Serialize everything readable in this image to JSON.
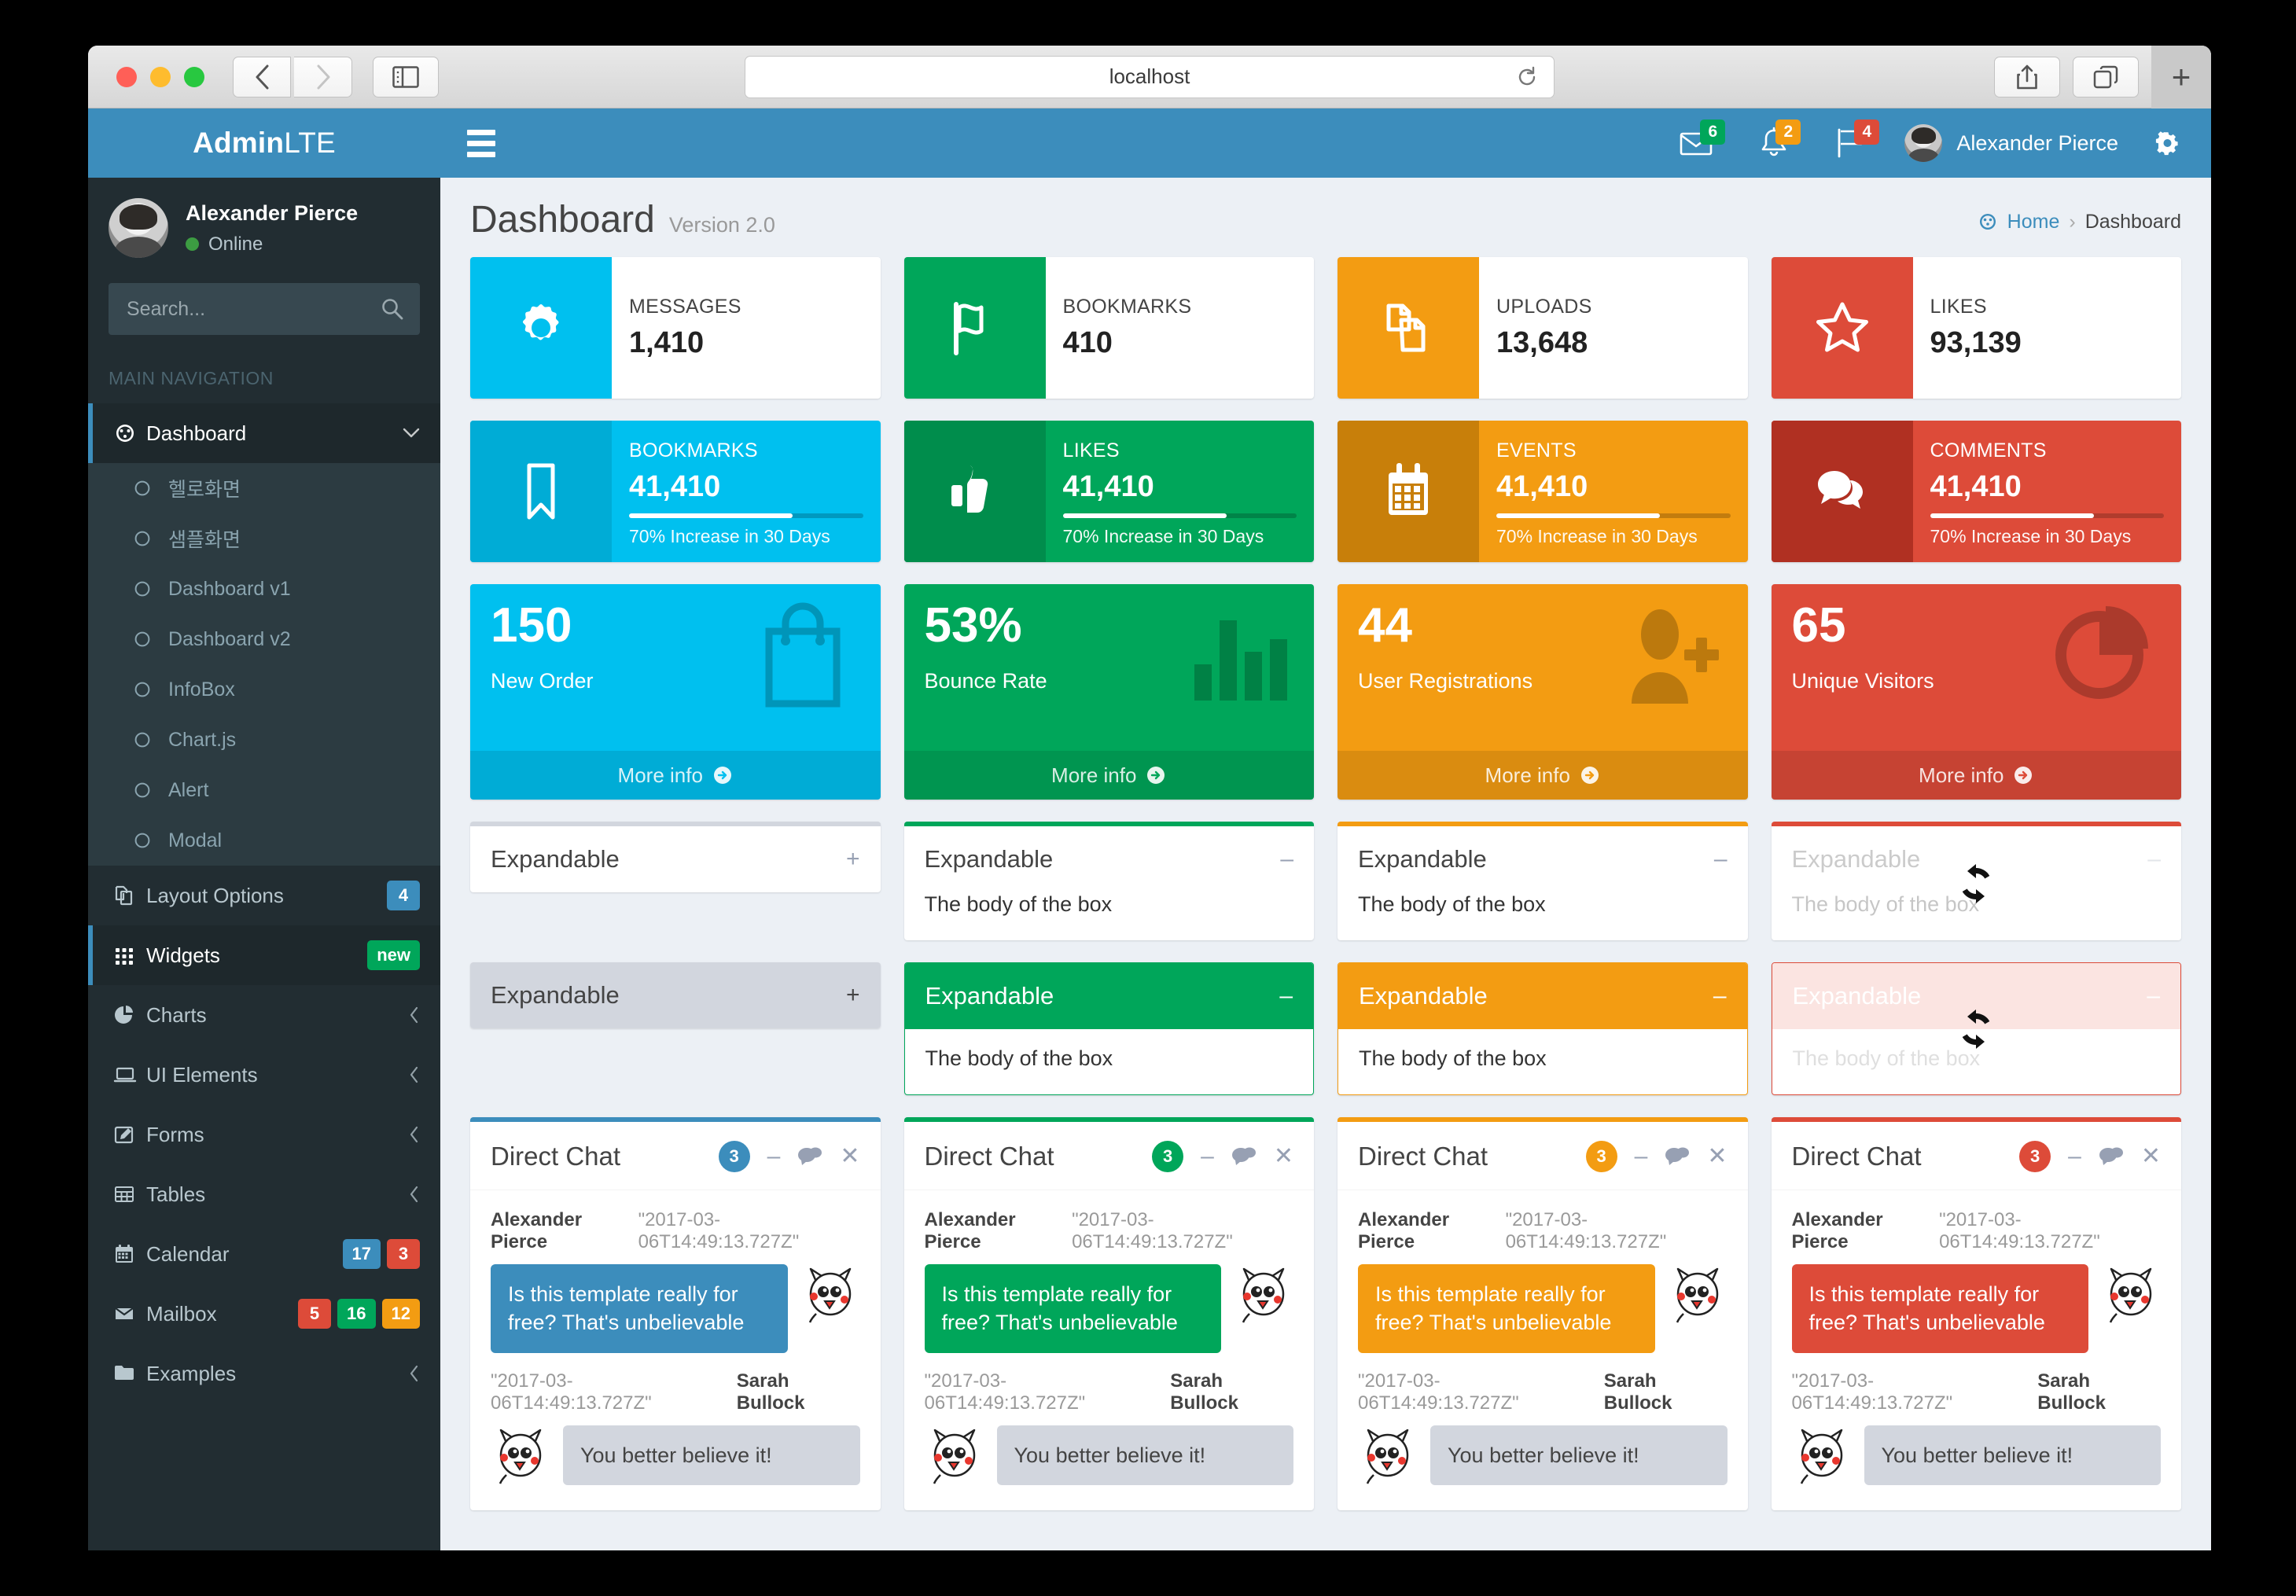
{
  "browser": {
    "url": "localhost",
    "back_label": "Back",
    "forward_label": "Forward",
    "sidebar_label": "Show Sidebar",
    "share_label": "Share",
    "tabs_label": "Show Tabs",
    "newtab_label": "+",
    "reload_label": "Reload"
  },
  "sidebar": {
    "logo_bold": "Admin",
    "logo_light": "LTE",
    "user": {
      "name": "Alexander Pierce",
      "status": "Online"
    },
    "search": {
      "placeholder": "Search...",
      "value": ""
    },
    "nav_header": "MAIN NAVIGATION",
    "items": [
      {
        "label": "Dashboard",
        "icon": "dashboard-icon",
        "active": true,
        "caret": "chevron-down"
      },
      {
        "label": "Layout Options",
        "icon": "copy-icon",
        "badges": [
          {
            "text": "4",
            "color": "blue"
          }
        ]
      },
      {
        "label": "Widgets",
        "icon": "grid-icon",
        "active": true,
        "badges": [
          {
            "text": "new",
            "color": "green"
          }
        ]
      },
      {
        "label": "Charts",
        "icon": "pie-icon",
        "caret": "chevron-left"
      },
      {
        "label": "UI Elements",
        "icon": "laptop-icon",
        "caret": "chevron-left"
      },
      {
        "label": "Forms",
        "icon": "edit-icon",
        "caret": "chevron-left"
      },
      {
        "label": "Tables",
        "icon": "table-icon",
        "caret": "chevron-left"
      },
      {
        "label": "Calendar",
        "icon": "calendar-icon",
        "badges": [
          {
            "text": "17",
            "color": "blue"
          },
          {
            "text": "3",
            "color": "red"
          }
        ]
      },
      {
        "label": "Mailbox",
        "icon": "envelope-icon",
        "badges": [
          {
            "text": "5",
            "color": "red"
          },
          {
            "text": "16",
            "color": "green"
          },
          {
            "text": "12",
            "color": "yellow"
          }
        ]
      },
      {
        "label": "Examples",
        "icon": "folder-icon",
        "caret": "chevron-left"
      }
    ],
    "subitems": [
      {
        "label": "헬로화면"
      },
      {
        "label": "샘플화면"
      },
      {
        "label": "Dashboard v1"
      },
      {
        "label": "Dashboard v2"
      },
      {
        "label": "InfoBox"
      },
      {
        "label": "Chart.js"
      },
      {
        "label": "Alert"
      },
      {
        "label": "Modal"
      }
    ]
  },
  "navbar": {
    "toggle_label": "Toggle navigation",
    "icons": [
      {
        "name": "envelope-icon",
        "count": "6",
        "color": "#00a65a"
      },
      {
        "name": "bell-icon",
        "count": "2",
        "color": "#f39c12"
      },
      {
        "name": "flag-icon",
        "count": "4",
        "color": "#dd4b39"
      }
    ],
    "user_name": "Alexander Pierce",
    "settings_label": "Control Sidebar"
  },
  "header": {
    "title": "Dashboard",
    "subtitle": "Version 2.0",
    "breadcrumb": [
      {
        "label": "Home",
        "icon": "dashboard-icon"
      },
      {
        "label": "Dashboard"
      }
    ],
    "breadcrumb_sep": "›"
  },
  "info_boxes_plain": [
    {
      "text": "MESSAGES",
      "number": "1,410",
      "icon": "gear-icon",
      "color": "#00c0ef"
    },
    {
      "text": "BOOKMARKS",
      "number": "410",
      "icon": "flag-icon",
      "color": "#00a65a"
    },
    {
      "text": "UPLOADS",
      "number": "13,648",
      "icon": "files-icon",
      "color": "#f39c12"
    },
    {
      "text": "LIKES",
      "number": "93,139",
      "icon": "star-icon",
      "color": "#dd4b39"
    }
  ],
  "info_boxes_filled": [
    {
      "text": "BOOKMARKS",
      "number": "41,410",
      "icon": "bookmark-icon",
      "progress": 70,
      "desc": "70% Increase in 30 Days",
      "color": "#00c0ef",
      "icon_bg": "#00acd6"
    },
    {
      "text": "LIKES",
      "number": "41,410",
      "icon": "thumbs-up-icon",
      "progress": 70,
      "desc": "70% Increase in 30 Days",
      "color": "#00a65a",
      "icon_bg": "#008d4c"
    },
    {
      "text": "EVENTS",
      "number": "41,410",
      "icon": "calendar-icon",
      "progress": 70,
      "desc": "70% Increase in 30 Days",
      "color": "#f39c12",
      "icon_bg": "#c87f0a"
    },
    {
      "text": "COMMENTS",
      "number": "41,410",
      "icon": "comments-icon",
      "progress": 70,
      "desc": "70% Increase in 30 Days",
      "color": "#dd4b39",
      "icon_bg": "#b03022"
    }
  ],
  "small_boxes": [
    {
      "value": "150",
      "label": "New Order",
      "icon": "shopping-bag-icon",
      "footer": "More info",
      "color": "#00c0ef"
    },
    {
      "value": "53%",
      "label": "Bounce Rate",
      "icon": "bar-chart-icon",
      "footer": "More info",
      "color": "#00a65a"
    },
    {
      "value": "44",
      "label": "User Registrations",
      "icon": "user-plus-icon",
      "footer": "More info",
      "color": "#f39c12"
    },
    {
      "value": "65",
      "label": "Unique Visitors",
      "icon": "pie-chart-icon",
      "footer": "More info",
      "color": "#dd4b39"
    }
  ],
  "expandable_row1": [
    {
      "title": "Expandable",
      "tool": "+",
      "body": "",
      "border_color": "#d2d6de",
      "collapsed": true,
      "loading": false
    },
    {
      "title": "Expandable",
      "tool": "–",
      "body": "The body of the box",
      "border_color": "#00a65a",
      "collapsed": false,
      "loading": false
    },
    {
      "title": "Expandable",
      "tool": "–",
      "body": "The body of the box",
      "border_color": "#f39c12",
      "collapsed": false,
      "loading": false
    },
    {
      "title": "Expandable",
      "tool": "–",
      "body": "The body of the box",
      "border_color": "#dd4b39",
      "collapsed": false,
      "loading": true
    }
  ],
  "expandable_row2": [
    {
      "title": "Expandable",
      "tool": "+",
      "body": "",
      "header_bg": "#d2d6de",
      "title_color": "#444",
      "collapsed": true,
      "loading": false
    },
    {
      "title": "Expandable",
      "tool": "–",
      "body": "The body of the box",
      "header_bg": "#00a65a",
      "title_color": "#fff",
      "collapsed": false,
      "loading": false
    },
    {
      "title": "Expandable",
      "tool": "–",
      "body": "The body of the box",
      "header_bg": "#f39c12",
      "title_color": "#fff",
      "collapsed": false,
      "loading": false
    },
    {
      "title": "Expandable",
      "tool": "–",
      "body": "The body of the box",
      "header_bg": "#f5c3bd",
      "title_color": "#fff",
      "collapsed": false,
      "loading": true,
      "border_color": "#dd4b39"
    }
  ],
  "chat_boxes": [
    {
      "title": "Direct Chat",
      "badge": "3",
      "badge_color": "#3c8dbc",
      "border_color": "#3c8dbc",
      "bubble_color": "#3c8dbc"
    },
    {
      "title": "Direct Chat",
      "badge": "3",
      "badge_color": "#00a65a",
      "border_color": "#00a65a",
      "bubble_color": "#00a65a"
    },
    {
      "title": "Direct Chat",
      "badge": "3",
      "badge_color": "#f39c12",
      "border_color": "#f39c12",
      "bubble_color": "#f39c12"
    },
    {
      "title": "Direct Chat",
      "badge": "3",
      "badge_color": "#dd4b39",
      "border_color": "#dd4b39",
      "bubble_color": "#dd4b39"
    }
  ],
  "chat_messages": {
    "out_name": "Alexander Pierce",
    "out_time": "\"2017-03-06T14:49:13.727Z\"",
    "out_text": "Is this template really for free? That's unbelievable",
    "in_name": "Sarah Bullock",
    "in_time": "\"2017-03-06T14:49:13.727Z\"",
    "in_text": "You better believe it!"
  },
  "chat_tool_labels": {
    "minimize": "–",
    "contacts": "contacts-icon",
    "close": "✕"
  }
}
